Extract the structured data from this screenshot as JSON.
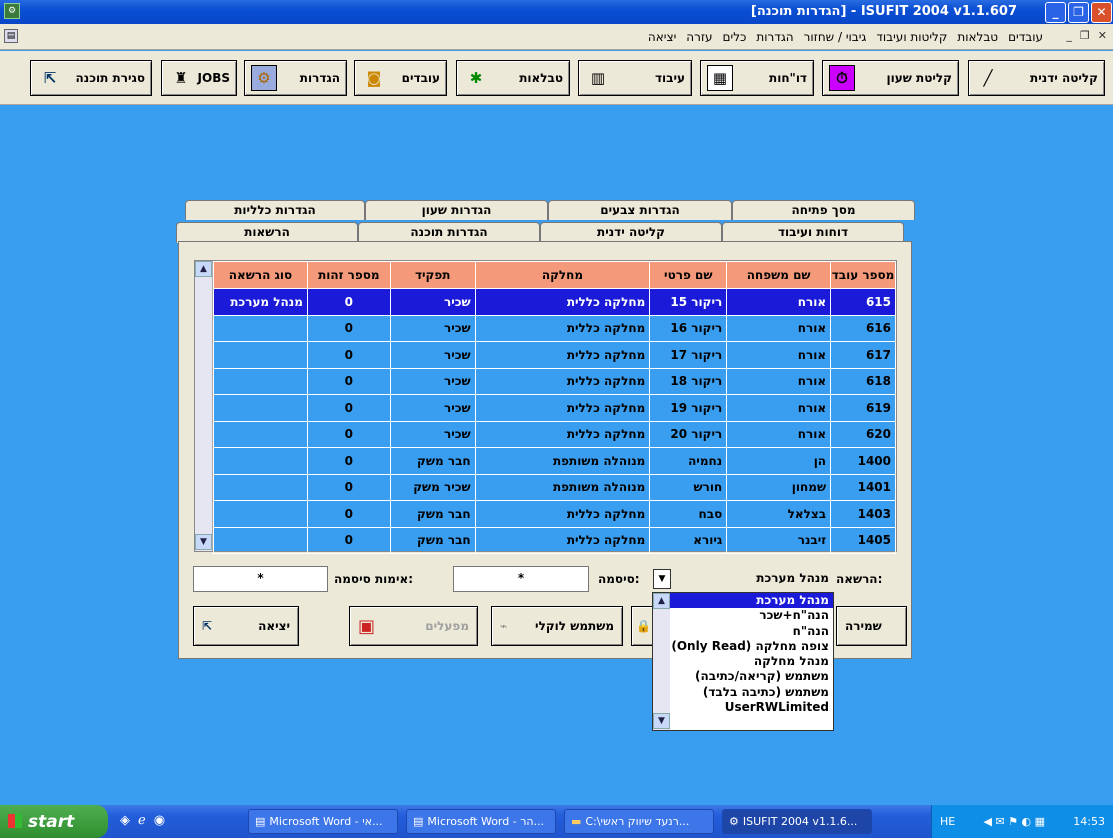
{
  "window": {
    "title": "[הגדרות תוכנה] - ISUFIT 2004  v1.1.607"
  },
  "menu": [
    "עובדים",
    "טבלאות",
    "קליטות ועיבוד",
    "גיבוי / שחזור",
    "הגדרות",
    "כלים",
    "עזרה",
    "יציאה"
  ],
  "toolbar": {
    "manual_entry": "קליטה ידנית",
    "clock_entry": "קליטת שעון",
    "reports": "דו\"חות",
    "processing": "עיבוד",
    "tables": "טבלאות",
    "workers": "עובדים",
    "settings": "הגדרות",
    "jobs": "JOBS",
    "close_program": "סגירת תוכנה"
  },
  "tabs_back": [
    "מסך פתיחה",
    "הגדרות צבעים",
    "הגדרות שעון",
    "הגדרות כלליות"
  ],
  "tabs_front": [
    "דוחות ועיבוד",
    "קליטה ידנית",
    "הגדרות תוכנה",
    "הרשאות"
  ],
  "grid": {
    "headers": [
      "מספר עובד",
      "שם משפחה",
      "שם פרטי",
      "מחלקה",
      "תפקיד",
      "מספר זהות",
      "סוג הרשאה"
    ],
    "rows": [
      [
        "615",
        "אורח",
        "ריקור 15",
        "מחלקה כללית",
        "שכיר",
        "0",
        "מנהל מערכת"
      ],
      [
        "616",
        "אורח",
        "ריקור 16",
        "מחלקה כללית",
        "שכיר",
        "0",
        ""
      ],
      [
        "617",
        "אורח",
        "ריקור 17",
        "מחלקה כללית",
        "שכיר",
        "0",
        ""
      ],
      [
        "618",
        "אורח",
        "ריקור 18",
        "מחלקה כללית",
        "שכיר",
        "0",
        ""
      ],
      [
        "619",
        "אורח",
        "ריקור 19",
        "מחלקה כללית",
        "שכיר",
        "0",
        ""
      ],
      [
        "620",
        "אורח",
        "ריקור 20",
        "מחלקה כללית",
        "שכיר",
        "0",
        ""
      ],
      [
        "1400",
        "הן",
        "נחמיה",
        "מנוהלה משותפת",
        "חבר משק",
        "0",
        ""
      ],
      [
        "1401",
        "שמחון",
        "חורש",
        "מנוהלה משותפת",
        "שכיר משק",
        "0",
        ""
      ],
      [
        "1403",
        "בצלאל",
        "סבח",
        "מחלקה כללית",
        "חבר משק",
        "0",
        ""
      ],
      [
        "1405",
        "זיבנר",
        "גיורא",
        "מחלקה כללית",
        "חבר משק",
        "0",
        ""
      ]
    ]
  },
  "form": {
    "permission_label": "הרשאה:",
    "permission_value": "מנהל מערכת",
    "password_label": "סיסמה:",
    "password_value": "*",
    "confirm_label": "אימות סיסמה:",
    "confirm_value": "*"
  },
  "dropdown_options": [
    "מנהל מערכת",
    "הנה\"ח+שכר",
    "הנה\"ח",
    "(Only Read) צופה מחלקה",
    "מנהל מחלקה",
    "משתמש (קריאה/כתיבה)",
    "משתמש (כתיבה בלבד)",
    "UserRWLimited"
  ],
  "buttons": {
    "save": "שמירה",
    "local_user": "משתמש לוקלי",
    "factories": "מפעלים",
    "exit": "יציאה"
  },
  "taskbar": {
    "start": "start",
    "tasks": [
      "Microsoft Word - אי...",
      "Microsoft Word - הר...",
      "C:\\רנעד שיווק ראשי...",
      "ISUFIT 2004  v1.1.6..."
    ],
    "lang": "HE",
    "clock": "14:53"
  }
}
